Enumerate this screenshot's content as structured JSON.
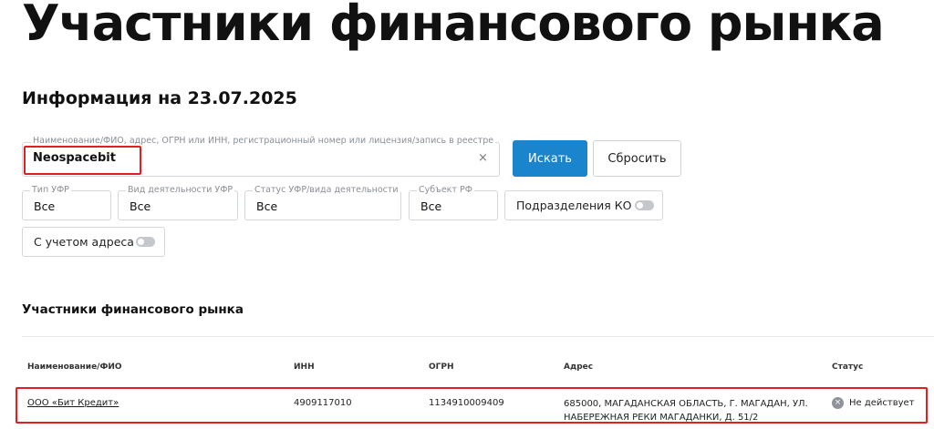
{
  "header": {
    "title": "Участники финансового рынка",
    "info_date": "Информация на 23.07.2025"
  },
  "search": {
    "legend": "Наименование/ФИО, адрес, ОГРН или ИНН, регистрационный номер или лицензия/запись в реестре",
    "value": "Neospacebit",
    "clear_icon": "×",
    "search_button": "Искать",
    "reset_button": "Сбросить"
  },
  "filters": {
    "type_ufr": {
      "legend": "Тип УФР",
      "value": "Все"
    },
    "activity": {
      "legend": "Вид деятельности УФР",
      "value": "Все"
    },
    "status": {
      "legend": "Статус УФР/вида деятельности",
      "value": "Все"
    },
    "subject": {
      "legend": "Субъект РФ",
      "value": "Все"
    },
    "ko_subdivisions": {
      "label": "Подразделения КО",
      "enabled": false
    },
    "with_address": {
      "label": "С учетом адреса",
      "enabled": false
    }
  },
  "results": {
    "title": "Участники финансового рынка",
    "columns": [
      "Наименование/ФИО",
      "ИНН",
      "ОГРН",
      "Адрес",
      "Статус"
    ],
    "rows": [
      {
        "name": "ООО «Бит Кредит»",
        "inn": "4909117010",
        "ogrn": "1134910009409",
        "address_line1": "685000, МАГАДАНСКАЯ ОБЛАСТЬ, Г. МАГАДАН, УЛ.",
        "address_line2": "НАБЕРЕЖНАЯ РЕКИ МАГАДАНКИ, Д. 51/2",
        "status_icon": "×",
        "status": "Не действует"
      }
    ]
  },
  "colors": {
    "accent": "#1a85cc",
    "highlight": "#e02020",
    "status_inactive": "#8e9399"
  }
}
